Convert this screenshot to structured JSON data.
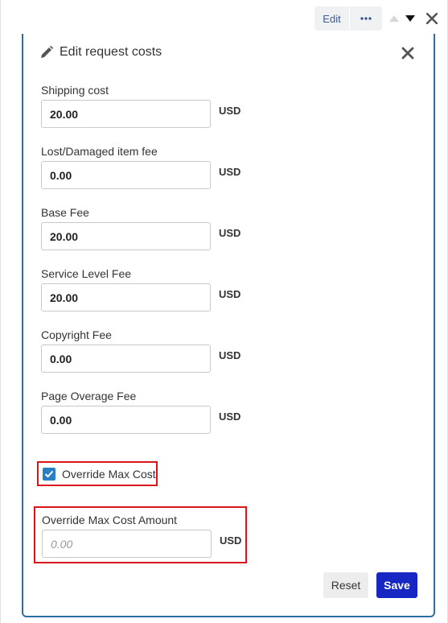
{
  "top_controls": {
    "edit_label": "Edit",
    "more_icon": "more-dots-icon",
    "up_icon": "arrow-up-icon",
    "down_icon": "arrow-down-icon",
    "close_icon": "close-icon"
  },
  "panel": {
    "title": "Edit request costs",
    "title_icon": "pencil-icon",
    "close_icon": "close-icon"
  },
  "fields": [
    {
      "label": "Shipping cost",
      "value": "20.00",
      "currency": "USD"
    },
    {
      "label": "Lost/Damaged item fee",
      "value": "0.00",
      "currency": "USD"
    },
    {
      "label": "Base Fee",
      "value": "20.00",
      "currency": "USD"
    },
    {
      "label": "Service Level Fee",
      "value": "20.00",
      "currency": "USD"
    },
    {
      "label": "Copyright Fee",
      "value": "0.00",
      "currency": "USD"
    },
    {
      "label": "Page Overage Fee",
      "value": "0.00",
      "currency": "USD"
    }
  ],
  "override": {
    "checkbox_label": "Override Max Cost",
    "checked": true,
    "amount_label": "Override Max Cost Amount",
    "amount_value": "",
    "amount_placeholder": "0.00",
    "amount_currency": "USD"
  },
  "footer": {
    "reset_label": "Reset",
    "save_label": "Save"
  },
  "colors": {
    "panel_border": "#2c6fa3",
    "highlight_border": "#d9161c",
    "save_button": "#1627c4",
    "checkbox": "#2a7ec2"
  }
}
